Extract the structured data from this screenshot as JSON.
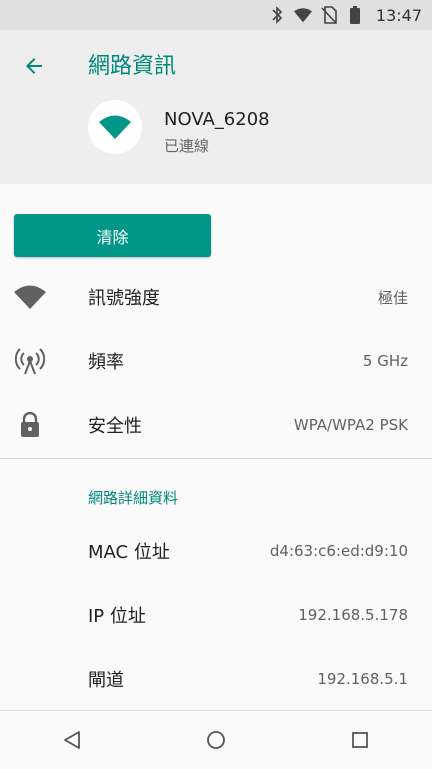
{
  "status_bar": {
    "time": "13:47"
  },
  "header": {
    "title": "網路資訊",
    "network_name": "NOVA_6208",
    "network_status": "已連線",
    "accent": "#00897b"
  },
  "clear_button": {
    "label": "清除",
    "color": "#009688"
  },
  "rows": [
    {
      "icon": "wifi-signal-icon",
      "label": "訊號強度",
      "value": "極佳"
    },
    {
      "icon": "antenna-frequency-icon",
      "label": "頻率",
      "value": "5 GHz"
    },
    {
      "icon": "lock-icon",
      "label": "安全性",
      "value": "WPA/WPA2 PSK"
    }
  ],
  "details": {
    "section_title": "網路詳細資料",
    "rows": [
      {
        "label": "MAC 位址",
        "value": "d4:63:c6:ed:d9:10"
      },
      {
        "label": "IP 位址",
        "value": "192.168.5.178"
      },
      {
        "label": "閘道",
        "value": "192.168.5.1"
      }
    ]
  },
  "nav": {
    "back": "back-icon",
    "home": "home-icon",
    "recents": "recents-icon"
  }
}
